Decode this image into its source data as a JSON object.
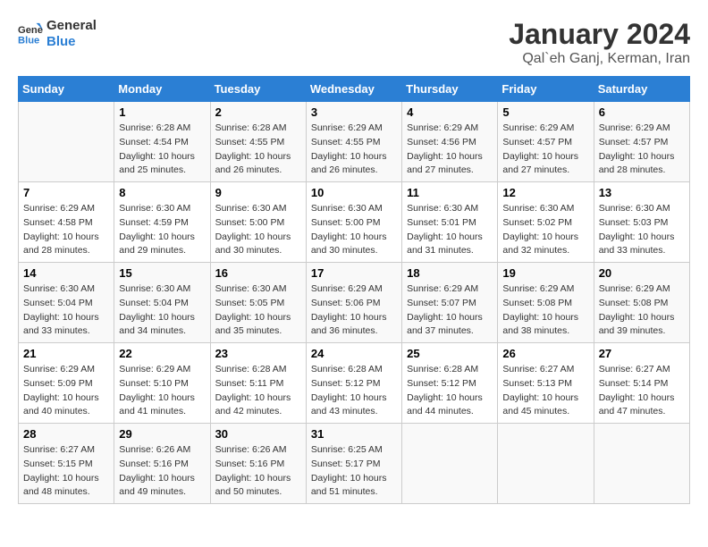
{
  "header": {
    "logo_line1": "General",
    "logo_line2": "Blue",
    "month_title": "January 2024",
    "subtitle": "Qal`eh Ganj, Kerman, Iran"
  },
  "weekdays": [
    "Sunday",
    "Monday",
    "Tuesday",
    "Wednesday",
    "Thursday",
    "Friday",
    "Saturday"
  ],
  "weeks": [
    [
      {
        "day": "",
        "sunrise": "",
        "sunset": "",
        "daylight": ""
      },
      {
        "day": "1",
        "sunrise": "Sunrise: 6:28 AM",
        "sunset": "Sunset: 4:54 PM",
        "daylight": "Daylight: 10 hours and 25 minutes."
      },
      {
        "day": "2",
        "sunrise": "Sunrise: 6:28 AM",
        "sunset": "Sunset: 4:55 PM",
        "daylight": "Daylight: 10 hours and 26 minutes."
      },
      {
        "day": "3",
        "sunrise": "Sunrise: 6:29 AM",
        "sunset": "Sunset: 4:55 PM",
        "daylight": "Daylight: 10 hours and 26 minutes."
      },
      {
        "day": "4",
        "sunrise": "Sunrise: 6:29 AM",
        "sunset": "Sunset: 4:56 PM",
        "daylight": "Daylight: 10 hours and 27 minutes."
      },
      {
        "day": "5",
        "sunrise": "Sunrise: 6:29 AM",
        "sunset": "Sunset: 4:57 PM",
        "daylight": "Daylight: 10 hours and 27 minutes."
      },
      {
        "day": "6",
        "sunrise": "Sunrise: 6:29 AM",
        "sunset": "Sunset: 4:57 PM",
        "daylight": "Daylight: 10 hours and 28 minutes."
      }
    ],
    [
      {
        "day": "7",
        "sunrise": "Sunrise: 6:29 AM",
        "sunset": "Sunset: 4:58 PM",
        "daylight": "Daylight: 10 hours and 28 minutes."
      },
      {
        "day": "8",
        "sunrise": "Sunrise: 6:30 AM",
        "sunset": "Sunset: 4:59 PM",
        "daylight": "Daylight: 10 hours and 29 minutes."
      },
      {
        "day": "9",
        "sunrise": "Sunrise: 6:30 AM",
        "sunset": "Sunset: 5:00 PM",
        "daylight": "Daylight: 10 hours and 30 minutes."
      },
      {
        "day": "10",
        "sunrise": "Sunrise: 6:30 AM",
        "sunset": "Sunset: 5:00 PM",
        "daylight": "Daylight: 10 hours and 30 minutes."
      },
      {
        "day": "11",
        "sunrise": "Sunrise: 6:30 AM",
        "sunset": "Sunset: 5:01 PM",
        "daylight": "Daylight: 10 hours and 31 minutes."
      },
      {
        "day": "12",
        "sunrise": "Sunrise: 6:30 AM",
        "sunset": "Sunset: 5:02 PM",
        "daylight": "Daylight: 10 hours and 32 minutes."
      },
      {
        "day": "13",
        "sunrise": "Sunrise: 6:30 AM",
        "sunset": "Sunset: 5:03 PM",
        "daylight": "Daylight: 10 hours and 33 minutes."
      }
    ],
    [
      {
        "day": "14",
        "sunrise": "Sunrise: 6:30 AM",
        "sunset": "Sunset: 5:04 PM",
        "daylight": "Daylight: 10 hours and 33 minutes."
      },
      {
        "day": "15",
        "sunrise": "Sunrise: 6:30 AM",
        "sunset": "Sunset: 5:04 PM",
        "daylight": "Daylight: 10 hours and 34 minutes."
      },
      {
        "day": "16",
        "sunrise": "Sunrise: 6:30 AM",
        "sunset": "Sunset: 5:05 PM",
        "daylight": "Daylight: 10 hours and 35 minutes."
      },
      {
        "day": "17",
        "sunrise": "Sunrise: 6:29 AM",
        "sunset": "Sunset: 5:06 PM",
        "daylight": "Daylight: 10 hours and 36 minutes."
      },
      {
        "day": "18",
        "sunrise": "Sunrise: 6:29 AM",
        "sunset": "Sunset: 5:07 PM",
        "daylight": "Daylight: 10 hours and 37 minutes."
      },
      {
        "day": "19",
        "sunrise": "Sunrise: 6:29 AM",
        "sunset": "Sunset: 5:08 PM",
        "daylight": "Daylight: 10 hours and 38 minutes."
      },
      {
        "day": "20",
        "sunrise": "Sunrise: 6:29 AM",
        "sunset": "Sunset: 5:08 PM",
        "daylight": "Daylight: 10 hours and 39 minutes."
      }
    ],
    [
      {
        "day": "21",
        "sunrise": "Sunrise: 6:29 AM",
        "sunset": "Sunset: 5:09 PM",
        "daylight": "Daylight: 10 hours and 40 minutes."
      },
      {
        "day": "22",
        "sunrise": "Sunrise: 6:29 AM",
        "sunset": "Sunset: 5:10 PM",
        "daylight": "Daylight: 10 hours and 41 minutes."
      },
      {
        "day": "23",
        "sunrise": "Sunrise: 6:28 AM",
        "sunset": "Sunset: 5:11 PM",
        "daylight": "Daylight: 10 hours and 42 minutes."
      },
      {
        "day": "24",
        "sunrise": "Sunrise: 6:28 AM",
        "sunset": "Sunset: 5:12 PM",
        "daylight": "Daylight: 10 hours and 43 minutes."
      },
      {
        "day": "25",
        "sunrise": "Sunrise: 6:28 AM",
        "sunset": "Sunset: 5:12 PM",
        "daylight": "Daylight: 10 hours and 44 minutes."
      },
      {
        "day": "26",
        "sunrise": "Sunrise: 6:27 AM",
        "sunset": "Sunset: 5:13 PM",
        "daylight": "Daylight: 10 hours and 45 minutes."
      },
      {
        "day": "27",
        "sunrise": "Sunrise: 6:27 AM",
        "sunset": "Sunset: 5:14 PM",
        "daylight": "Daylight: 10 hours and 47 minutes."
      }
    ],
    [
      {
        "day": "28",
        "sunrise": "Sunrise: 6:27 AM",
        "sunset": "Sunset: 5:15 PM",
        "daylight": "Daylight: 10 hours and 48 minutes."
      },
      {
        "day": "29",
        "sunrise": "Sunrise: 6:26 AM",
        "sunset": "Sunset: 5:16 PM",
        "daylight": "Daylight: 10 hours and 49 minutes."
      },
      {
        "day": "30",
        "sunrise": "Sunrise: 6:26 AM",
        "sunset": "Sunset: 5:16 PM",
        "daylight": "Daylight: 10 hours and 50 minutes."
      },
      {
        "day": "31",
        "sunrise": "Sunrise: 6:25 AM",
        "sunset": "Sunset: 5:17 PM",
        "daylight": "Daylight: 10 hours and 51 minutes."
      },
      {
        "day": "",
        "sunrise": "",
        "sunset": "",
        "daylight": ""
      },
      {
        "day": "",
        "sunrise": "",
        "sunset": "",
        "daylight": ""
      },
      {
        "day": "",
        "sunrise": "",
        "sunset": "",
        "daylight": ""
      }
    ]
  ]
}
